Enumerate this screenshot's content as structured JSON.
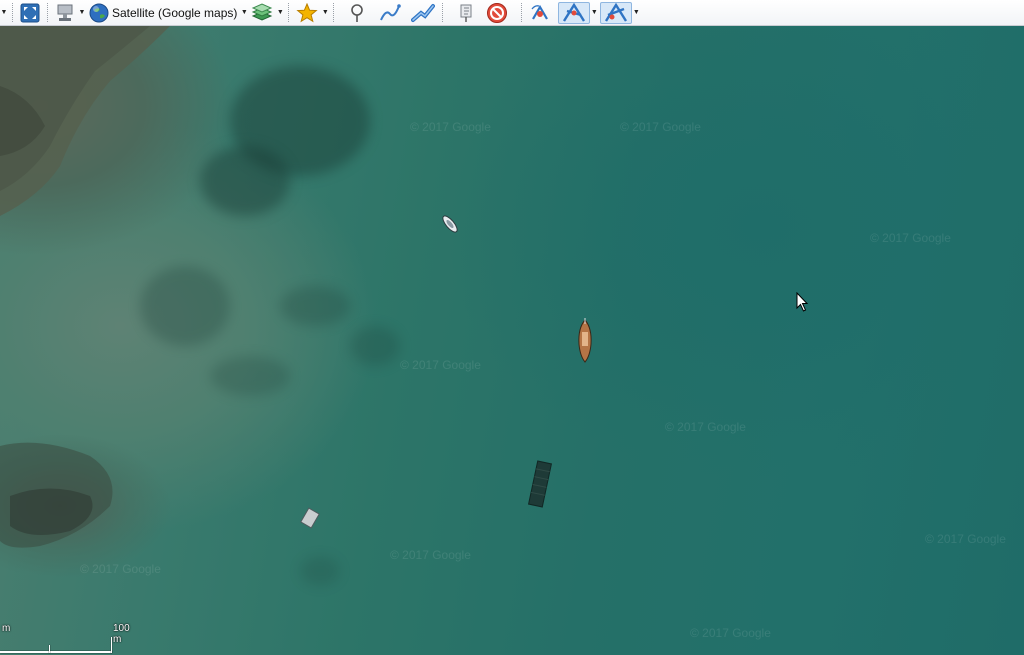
{
  "toolbar": {
    "map_type_label": "Satellite (Google maps)",
    "icons": [
      "fullscreen-icon",
      "tile-server-icon",
      "globe-icon",
      "layers-icon",
      "favorites-star-icon",
      "waypoint-icon",
      "route-icon",
      "track-icon",
      "tip-marker-icon",
      "stop-icon",
      "gps-icon",
      "gps-center-icon",
      "gps-track-icon"
    ]
  },
  "map": {
    "watermark": "© 2017 Google",
    "scale": {
      "left_label": "m",
      "right_label": "100 m"
    },
    "colors": {
      "water": "#2a7368",
      "shoal": "#4d6458"
    }
  }
}
